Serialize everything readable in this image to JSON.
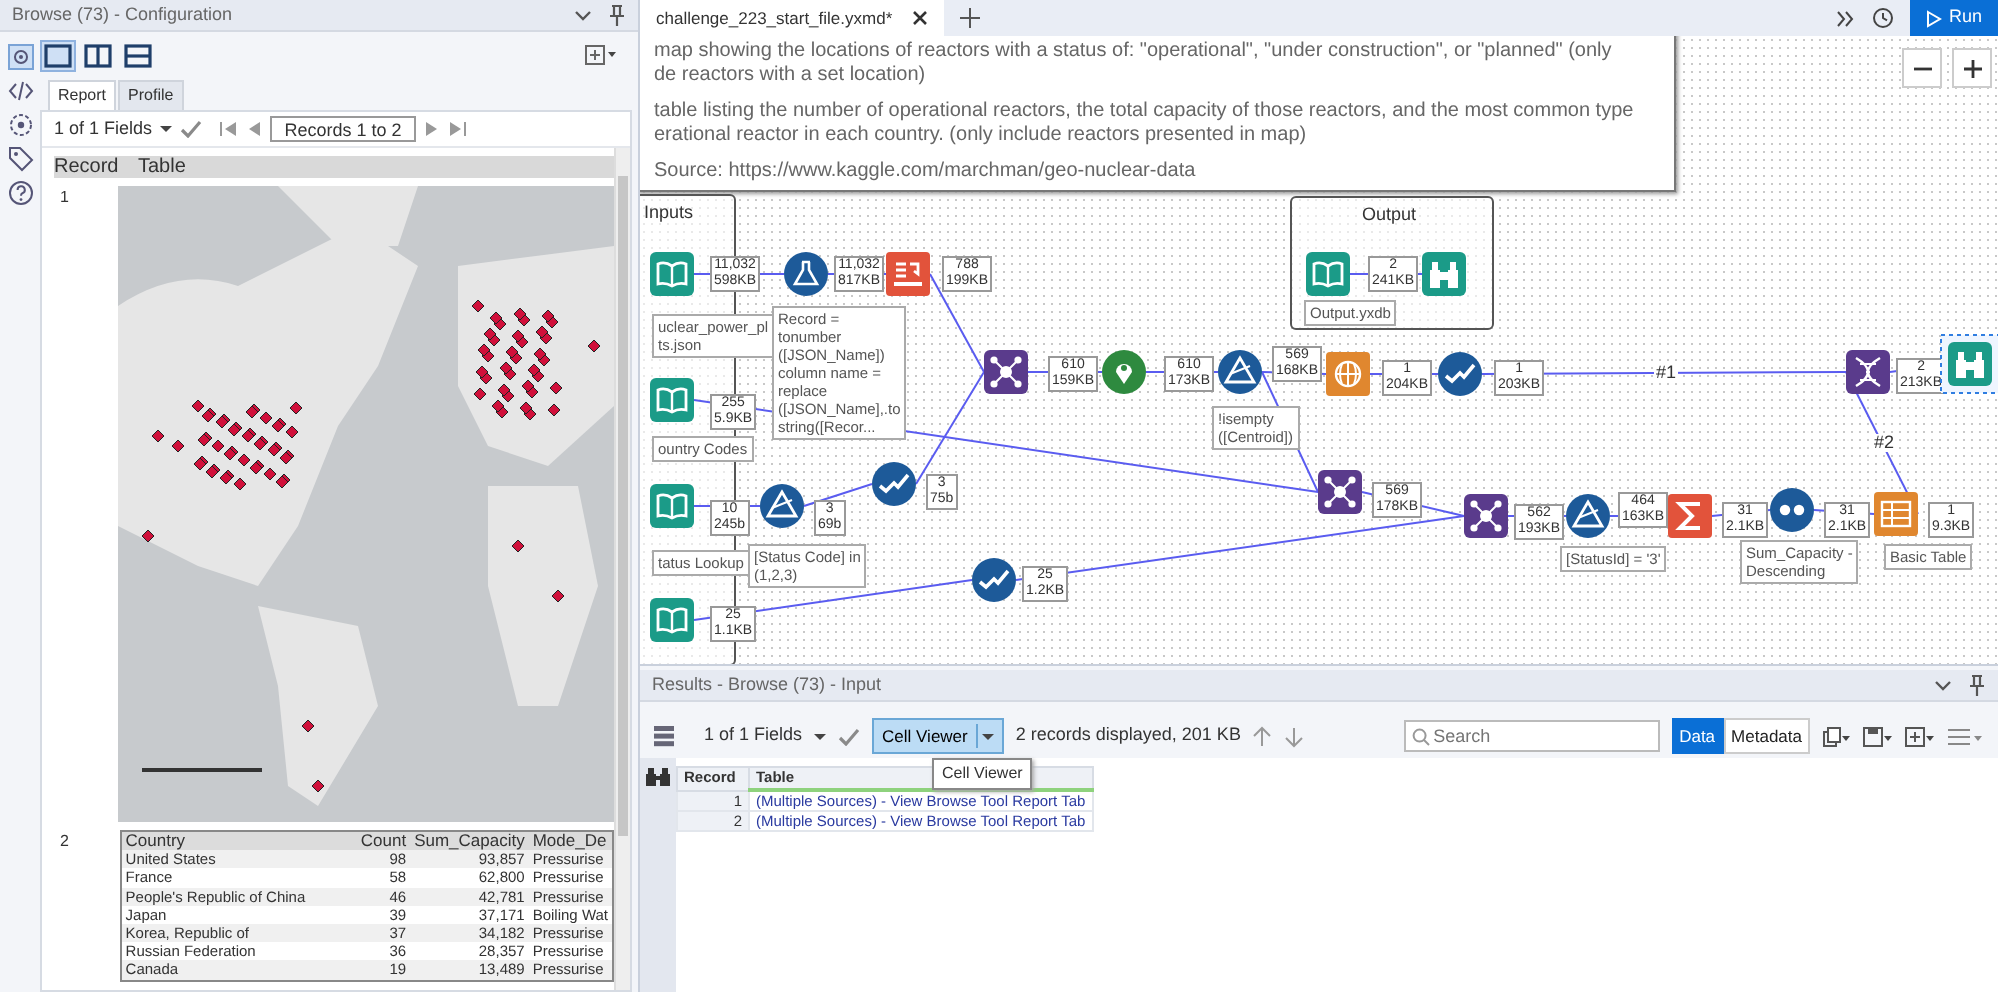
{
  "config_panel": {
    "title": "Browse (73) - Configuration",
    "layouts": [
      {
        "selected": true
      },
      {
        "selected": false
      },
      {
        "selected": false
      }
    ],
    "tabs": [
      {
        "label": "Report",
        "selected": true
      },
      {
        "label": "Profile",
        "selected": false
      }
    ],
    "fields": "1 of 1 Fields",
    "records": "Records 1 to 2",
    "columns": [
      "Record",
      "Table"
    ],
    "records_list": [
      {
        "record": "1",
        "kind": "map"
      },
      {
        "record": "2",
        "kind": "table",
        "columns": [
          "Country",
          "Count",
          "Sum_Capacity",
          "Mode_De"
        ],
        "rows": [
          [
            "United States",
            "98",
            "93,857",
            "Pressurise"
          ],
          [
            "France",
            "58",
            "62,800",
            "Pressurise"
          ],
          [
            "People's Republic of China",
            "46",
            "42,781",
            "Pressurise"
          ],
          [
            "Japan",
            "39",
            "37,171",
            "Boiling Wat"
          ],
          [
            "Korea, Republic of",
            "37",
            "34,182",
            "Pressurise"
          ],
          [
            "Russian Federation",
            "36",
            "28,357",
            "Pressurise"
          ],
          [
            "Canada",
            "19",
            "13,489",
            "Pressurise"
          ]
        ]
      }
    ]
  },
  "workflow": {
    "file_tab": "challenge_223_start_file.yxmd*",
    "run": "Run",
    "comment": [
      "map showing the locations of reactors with a status of: \"operational\", \"under construction\", or \"planned\" (only",
      "de reactors with a set location)",
      "table listing the number of operational reactors, the total capacity of those reactors, and the most common type",
      "erational reactor in each country. (only include reactors presented in map)",
      "Source:  https://www.kaggle.com/marchman/geo-nuclear-data"
    ],
    "containers": [
      {
        "title": "Inputs"
      },
      {
        "title": "Output"
      }
    ],
    "tools": [
      {
        "kind": "input",
        "count": "11,032",
        "size": "598KB",
        "annotation": "uclear_power_pl\nts.json",
        "selected": false
      },
      {
        "kind": "formula",
        "count": "11,032",
        "size": "817KB",
        "annotation": "Record =\ntonumber\n([JSON_Name])\ncolumn name =\nreplace\n([JSON_Name],.to\nstring([Recor...",
        "selected": false
      },
      {
        "kind": "parse",
        "count": "788",
        "size": "199KB",
        "selected": false
      },
      {
        "kind": "input",
        "count": "255",
        "size": "5.9KB",
        "annotation": "ountry Codes",
        "selected": false
      },
      {
        "kind": "input",
        "count": "10",
        "size": "245b",
        "annotation": "tatus Lookup",
        "selected": false
      },
      {
        "kind": "filter",
        "count": "3",
        "size": "69b",
        "annotation": "[Status Code] in\n(1,2,3)",
        "selected": false
      },
      {
        "kind": "select",
        "count": "3",
        "size": "75b",
        "selected": false
      },
      {
        "kind": "input",
        "count": "25",
        "size": "1.1KB",
        "selected": false
      },
      {
        "kind": "select",
        "count": "25",
        "size": "1.2KB",
        "selected": false
      },
      {
        "kind": "join",
        "count": "610",
        "size": "159KB",
        "selected": false
      },
      {
        "kind": "spatial",
        "count": "610",
        "size": "173KB",
        "selected": false
      },
      {
        "kind": "filter",
        "count": "569",
        "size": "168KB",
        "annotation": "!isempty\n([Centroid])",
        "selected": false
      },
      {
        "kind": "input",
        "count": "2",
        "size": "241KB",
        "annotation": "Output.yxdb",
        "selected": false
      },
      {
        "kind": "browse",
        "selected": false
      },
      {
        "kind": "web",
        "count": "1",
        "size": "204KB",
        "selected": false
      },
      {
        "kind": "select",
        "count": "1",
        "size": "203KB",
        "selected": false
      },
      {
        "kind": "layout",
        "count": "2",
        "size": "213KB",
        "selected": false
      },
      {
        "kind": "browse",
        "selected": true
      },
      {
        "kind": "join",
        "count": "569",
        "size": "178KB",
        "selected": false
      },
      {
        "kind": "join",
        "count": "562",
        "size": "193KB",
        "selected": false
      },
      {
        "kind": "filter",
        "count": "464",
        "size": "163KB",
        "annotation": "[StatusId] = '3'",
        "selected": false
      },
      {
        "kind": "summarize",
        "count": "31",
        "size": "2.1KB",
        "selected": false
      },
      {
        "kind": "sort",
        "count": "31",
        "size": "2.1KB",
        "annotation": "Sum_Capacity -\nDescending",
        "selected": false
      },
      {
        "kind": "table",
        "count": "1",
        "size": "9.3KB",
        "annotation": "Basic Table",
        "selected": false
      }
    ],
    "connection_labels": [
      "#1",
      "#2"
    ]
  },
  "results": {
    "title": "Results - Browse (73) - Input",
    "fields": "1 of 1 Fields",
    "viewer": {
      "label": "Cell Viewer",
      "selected": true
    },
    "summary": "2 records displayed, 201 KB",
    "search": {
      "placeholder": "Search"
    },
    "modes": [
      {
        "label": "Data",
        "selected": true
      },
      {
        "label": "Metadata",
        "selected": false
      }
    ],
    "tooltip": "Cell Viewer",
    "columns": [
      "Record",
      "Table"
    ],
    "rows": [
      {
        "record": "1",
        "table": "(Multiple Sources) - View Browse Tool Report Tab"
      },
      {
        "record": "2",
        "table": "(Multiple Sources) - View Browse Tool Report Tab"
      }
    ]
  }
}
